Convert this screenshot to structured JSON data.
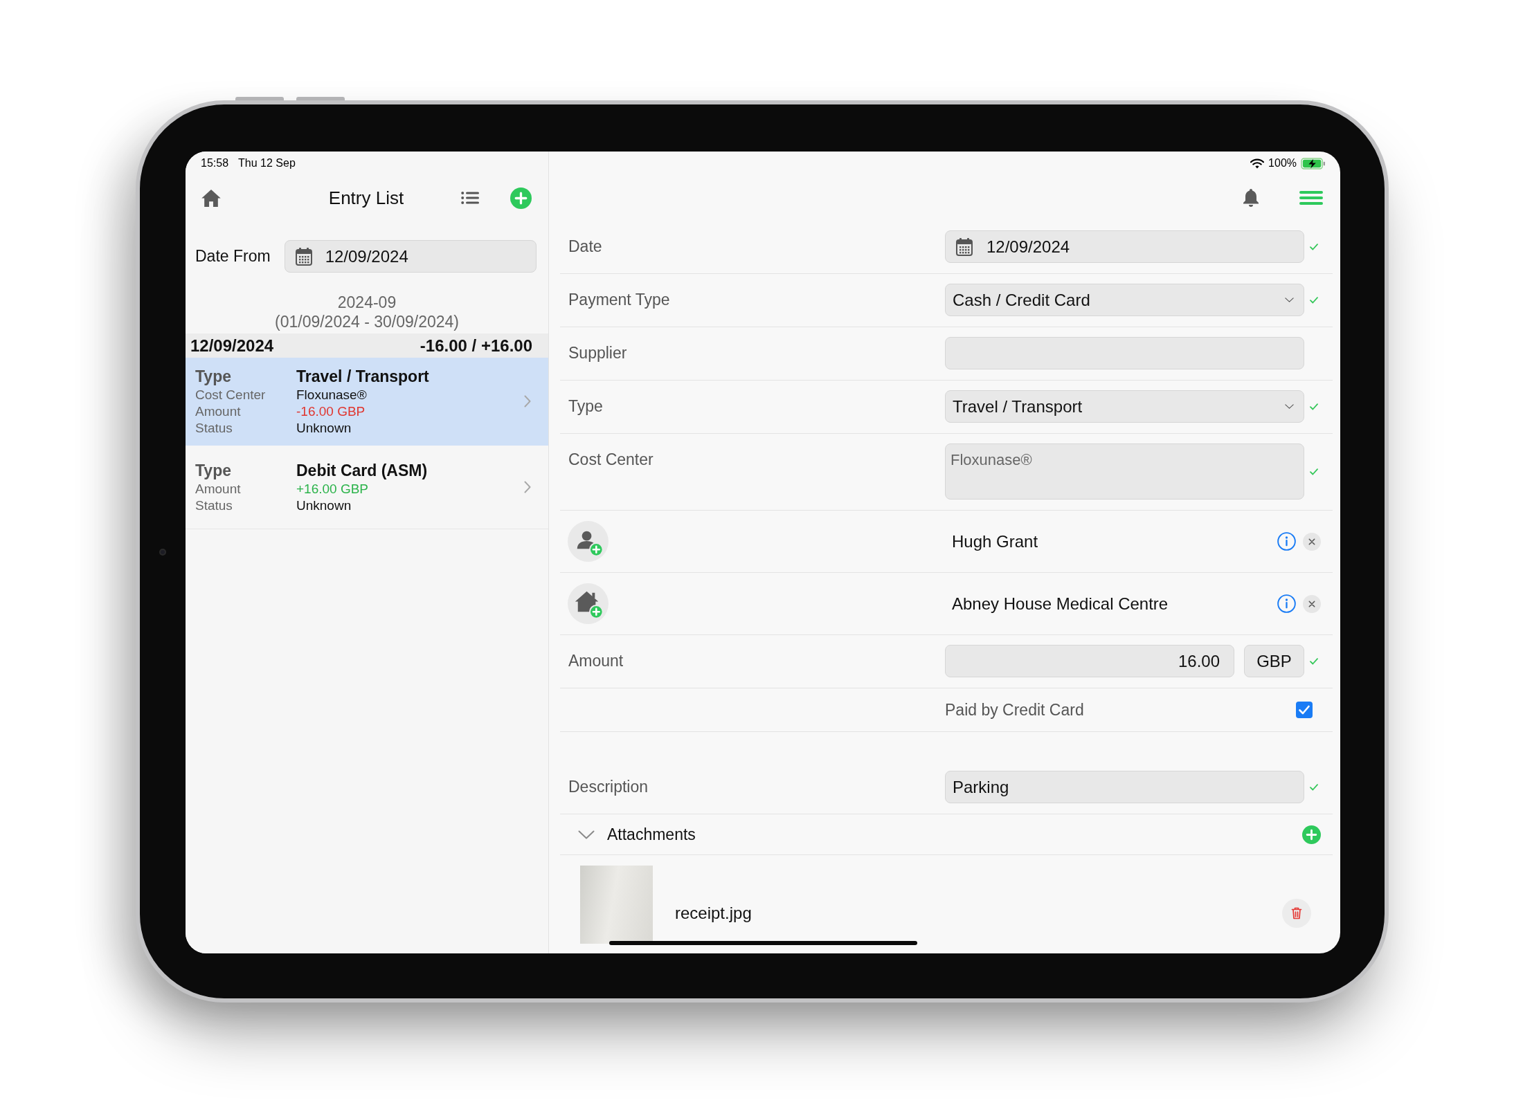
{
  "status_bar": {
    "time": "15:58",
    "date": "Thu 12 Sep",
    "battery": "100%"
  },
  "entry_list": {
    "title": "Entry List",
    "date_from": {
      "label": "Date From",
      "value": "12/09/2024"
    },
    "period": {
      "month": "2024-09",
      "range": "(01/09/2024 - 30/09/2024)"
    },
    "day": {
      "date": "12/09/2024",
      "totals": "-16.00 / +16.00"
    },
    "entries": [
      {
        "selected": true,
        "fields": [
          {
            "kind": "heading",
            "label": "Type",
            "value": "Travel / Transport"
          },
          {
            "kind": "plain",
            "label": "Cost Center",
            "value": "Floxunase®"
          },
          {
            "kind": "debit",
            "label": "Amount",
            "value": "-16.00 GBP"
          },
          {
            "kind": "plain",
            "label": "Status",
            "value": "Unknown"
          }
        ]
      },
      {
        "selected": false,
        "fields": [
          {
            "kind": "heading",
            "label": "Type",
            "value": "Debit Card (ASM)"
          },
          {
            "kind": "credit",
            "label": "Amount",
            "value": "+16.00 GBP"
          },
          {
            "kind": "plain",
            "label": "Status",
            "value": "Unknown"
          }
        ]
      }
    ]
  },
  "form": {
    "rows": [
      {
        "kind": "date",
        "label": "Date",
        "value": "12/09/2024",
        "valid": true
      },
      {
        "kind": "select",
        "label": "Payment Type",
        "value": "Cash / Credit Card",
        "valid": true
      },
      {
        "kind": "text",
        "label": "Supplier",
        "valid": false
      },
      {
        "kind": "select",
        "label": "Type",
        "value": "Travel / Transport",
        "valid": true
      },
      {
        "kind": "textarea",
        "label": "Cost Center",
        "value": "Floxunase®",
        "disabled": true,
        "valid": true
      },
      {
        "kind": "person",
        "name": "Hugh Grant"
      },
      {
        "kind": "place",
        "name": "Abney House Medical Centre"
      },
      {
        "kind": "amount",
        "label": "Amount",
        "value": "16.00",
        "currency": "GBP",
        "valid": true
      },
      {
        "kind": "checkbox",
        "label": "Paid by Credit Card",
        "checked": true
      },
      {
        "kind": "text",
        "label": "Description",
        "value": "Parking",
        "valid": true
      }
    ]
  },
  "attachments": {
    "title": "Attachments",
    "expanded": true,
    "files": [
      {
        "name": "receipt.jpg"
      }
    ]
  }
}
